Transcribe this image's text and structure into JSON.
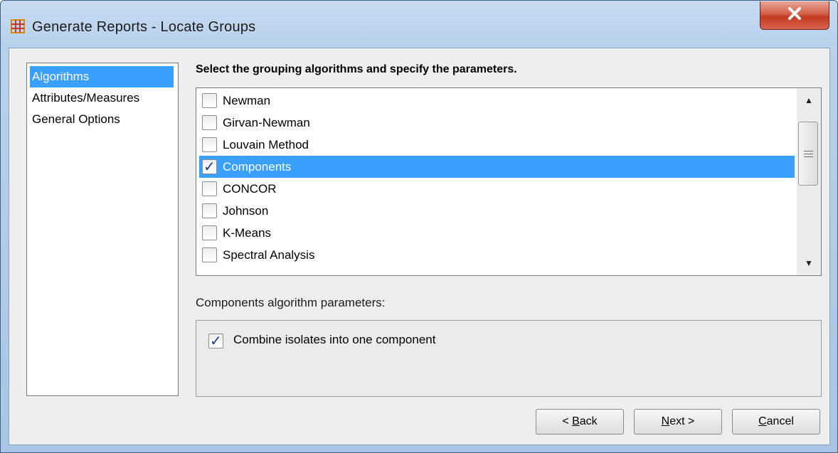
{
  "window": {
    "title": "Generate Reports - Locate Groups",
    "icon": "grid-app-icon",
    "close_label": "X",
    "title_accent": "#c23b22"
  },
  "nav": {
    "items": [
      {
        "label": "Algorithms",
        "selected": true
      },
      {
        "label": "Attributes/Measures",
        "selected": false
      },
      {
        "label": "General Options",
        "selected": false
      }
    ]
  },
  "main": {
    "instruction": "Select the grouping algorithms and specify the parameters.",
    "algorithms": [
      {
        "label": "Newman",
        "checked": false,
        "selected": false
      },
      {
        "label": "Girvan-Newman",
        "checked": false,
        "selected": false
      },
      {
        "label": "Louvain Method",
        "checked": false,
        "selected": false
      },
      {
        "label": "Components",
        "checked": true,
        "selected": true
      },
      {
        "label": "CONCOR",
        "checked": false,
        "selected": false
      },
      {
        "label": "Johnson",
        "checked": false,
        "selected": false
      },
      {
        "label": "K-Means",
        "checked": false,
        "selected": false
      },
      {
        "label": "Spectral Analysis",
        "checked": false,
        "selected": false
      }
    ],
    "params_label": "Components algorithm parameters:",
    "params": [
      {
        "label": "Combine isolates into one component",
        "checked": true
      }
    ]
  },
  "buttons": {
    "back": {
      "prefix": "< ",
      "mnemonic": "B",
      "rest": "ack"
    },
    "next": {
      "prefix": "",
      "mnemonic": "N",
      "rest": "ext >"
    },
    "cancel": {
      "prefix": "",
      "mnemonic": "C",
      "rest": "ancel"
    }
  },
  "colors": {
    "selection": "#39a0ff",
    "check": "#1e3a8a"
  }
}
